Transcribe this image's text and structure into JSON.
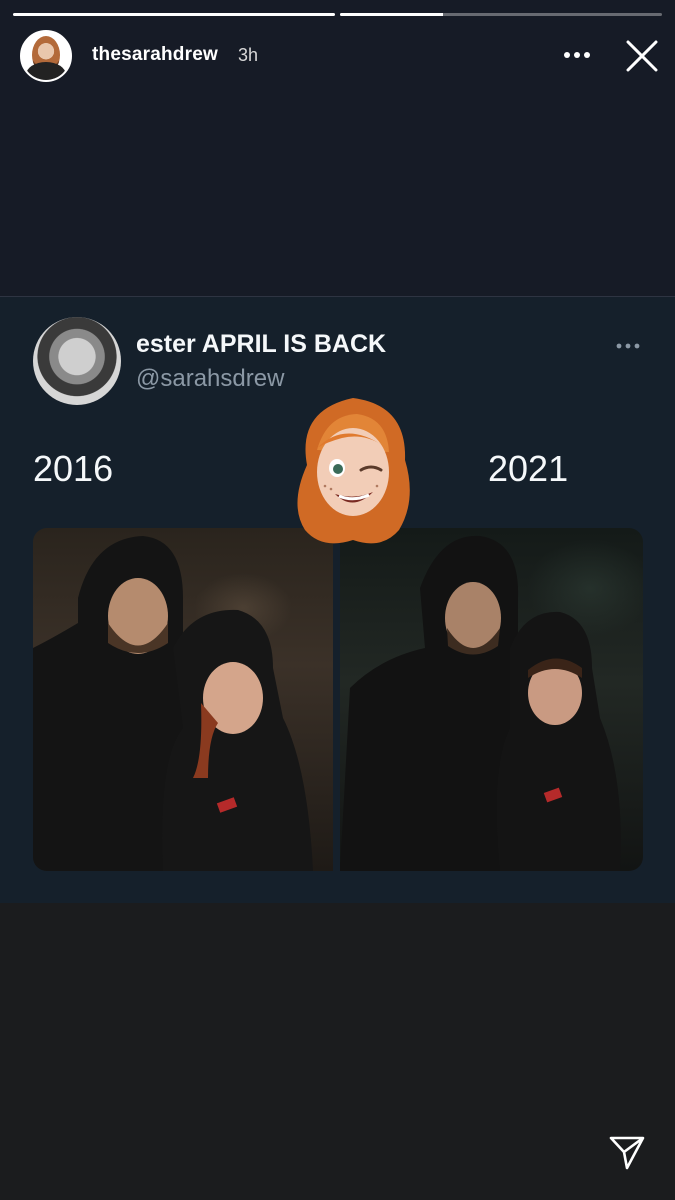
{
  "story": {
    "username": "thesarahdrew",
    "time_ago": "3h",
    "progress": [
      1.0,
      0.32
    ]
  },
  "tweet": {
    "display_name": "ester APRIL IS BACK",
    "handle": "@sarahsdrew",
    "year_left": "2016",
    "year_right": "2021"
  },
  "icons": {
    "more": "more-horizontal-icon",
    "close": "close-icon",
    "tweet_more": "more-horizontal-icon",
    "send": "send-paper-plane-icon"
  },
  "colors": {
    "tweet_bg": "#15202b",
    "story_bg": "#1b1c1e",
    "handle_gray": "#8b98a5"
  }
}
